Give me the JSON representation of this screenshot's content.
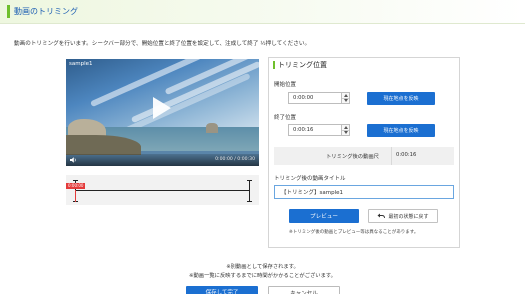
{
  "header": {
    "title": "動画のトリミング"
  },
  "intro": "動画のトリミングを行います。シークバー部分で、開始位置と終了位置を設定して、注成して終了 ½押してください。",
  "player": {
    "label": "sample1",
    "time": "0:00:00 / 0:00:30",
    "icons": {
      "play": "play-icon",
      "volume": "speaker-icon"
    }
  },
  "trim_bar": {
    "start_tag": "0:00:00"
  },
  "panel": {
    "heading": "トリミング位置",
    "start": {
      "label": "開始位置",
      "value": "0:00:00",
      "apply": "現在地点を反映"
    },
    "end": {
      "label": "終了位置",
      "value": "0:00:16",
      "apply": "現在地点を反映"
    },
    "length": {
      "label": "トリミング後の動画尺",
      "value": "0:00:16"
    },
    "title_field": {
      "label": "トリミング後の動画タイトル",
      "value": "【トリミング】sample1"
    },
    "preview_button": "プレビュー",
    "reset_button": "最初の状態に戻す",
    "reset_icon": "undo-arrow-icon",
    "note": "※トリミング後の動画とプレビュー等は異なることがあります。"
  },
  "footer": {
    "note1": "※別動画として保存されます。",
    "note2": "※動画一覧に反映するまでに時間がかかることがございます。",
    "save_button": "保存して完了",
    "cancel_button": "キャンセル"
  },
  "colors": {
    "accent_green": "#6fbf2c",
    "primary_blue": "#1b6fd1",
    "title_blue": "#1d5fb3",
    "trim_red": "#e43b3b"
  }
}
